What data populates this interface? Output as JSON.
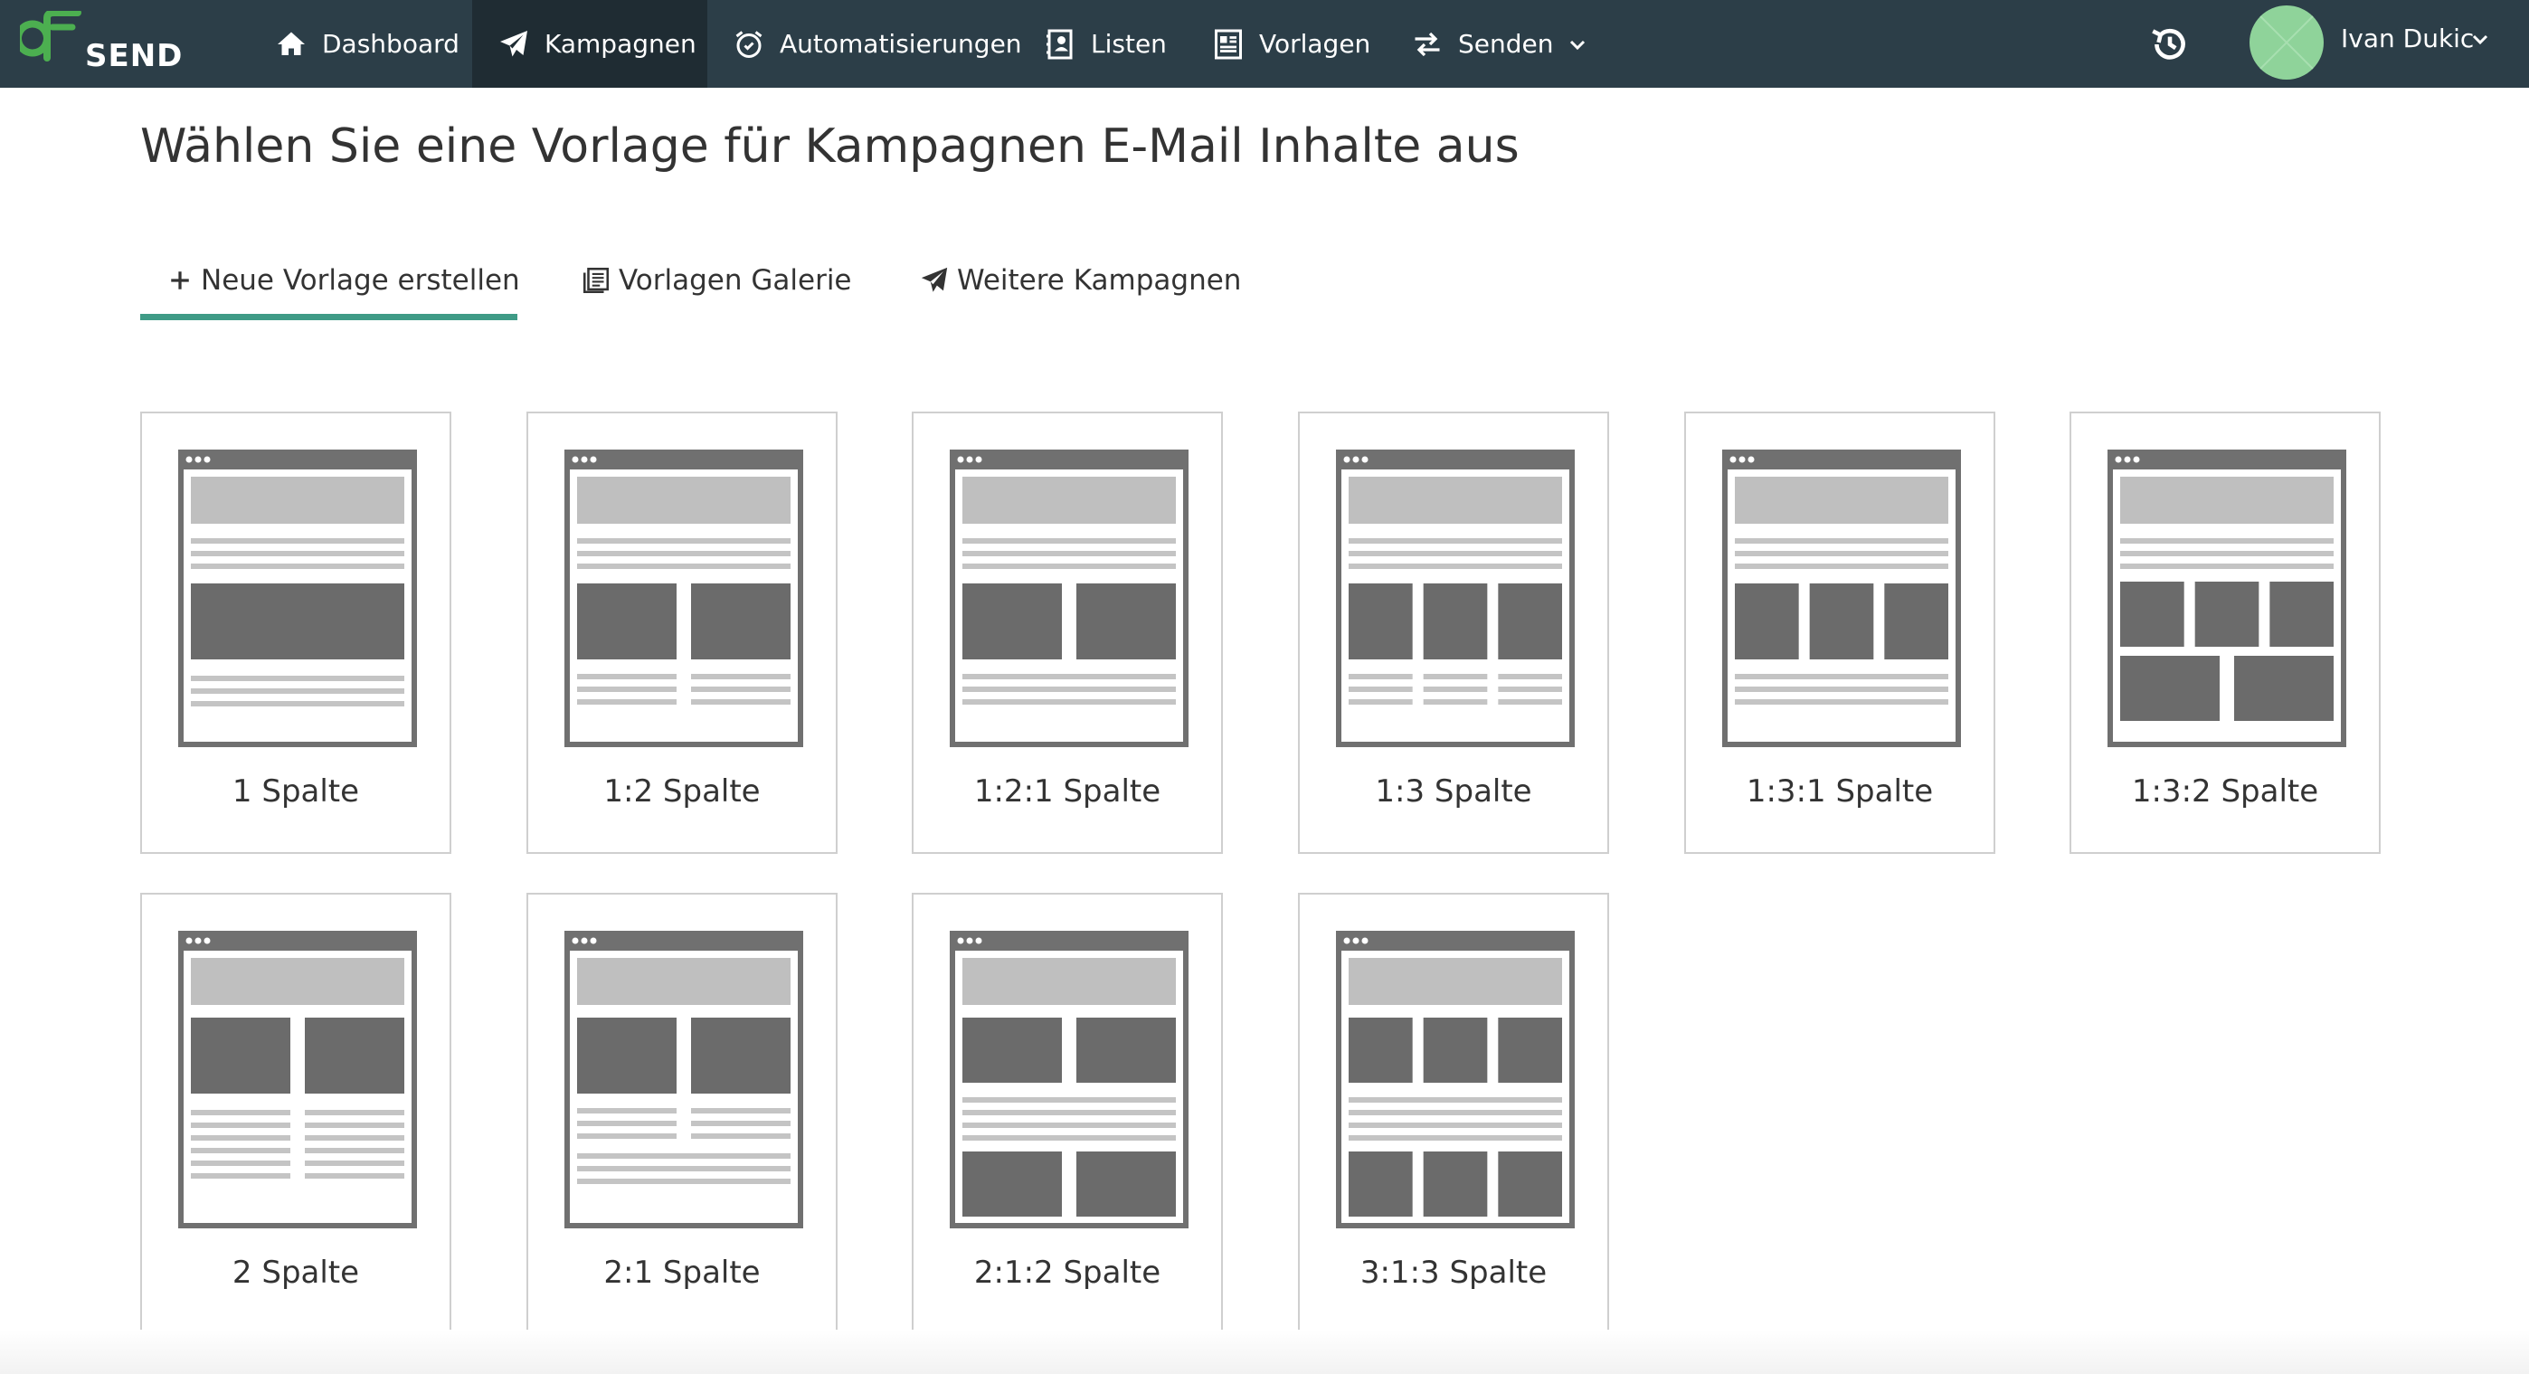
{
  "brand": {
    "logo_text": "SEND",
    "accent_color": "#3f9b86",
    "logo_color": "#4caf50"
  },
  "navbar": {
    "items": [
      {
        "label": "Dashboard",
        "icon": "home-icon"
      },
      {
        "label": "Kampagnen",
        "icon": "paper-plane-icon",
        "active": true
      },
      {
        "label": "Automatisierungen",
        "icon": "alarm-clock-icon"
      },
      {
        "label": "Listen",
        "icon": "contact-list-icon"
      },
      {
        "label": "Vorlagen",
        "icon": "template-icon"
      },
      {
        "label": "Senden",
        "icon": "exchange-arrows-icon",
        "has_dropdown": true
      }
    ],
    "history_icon": "history-icon",
    "user": {
      "name": "Ivan Dukic"
    }
  },
  "page": {
    "title": "Wählen Sie eine Vorlage für Kampagnen E-Mail Inhalte aus",
    "tabs": [
      {
        "label": "Neue Vorlage erstellen",
        "icon": "plus-icon",
        "active": true
      },
      {
        "label": "Vorlagen Galerie",
        "icon": "gallery-icon"
      },
      {
        "label": "Weitere Kampagnen",
        "icon": "paper-plane-icon"
      }
    ]
  },
  "templates": [
    {
      "label": "1 Spalte",
      "layout": "1"
    },
    {
      "label": "1:2 Spalte",
      "layout": "1:2"
    },
    {
      "label": "1:2:1 Spalte",
      "layout": "1:2:1"
    },
    {
      "label": "1:3 Spalte",
      "layout": "1:3"
    },
    {
      "label": "1:3:1 Spalte",
      "layout": "1:3:1"
    },
    {
      "label": "1:3:2 Spalte",
      "layout": "1:3:2"
    },
    {
      "label": "2 Spalte",
      "layout": "2"
    },
    {
      "label": "2:1 Spalte",
      "layout": "2:1"
    },
    {
      "label": "2:1:2 Spalte",
      "layout": "2:1:2"
    },
    {
      "label": "3:1:3 Spalte",
      "layout": "3:1:3"
    }
  ],
  "colors": {
    "navbar_bg": "#2c3e48",
    "navbar_active": "#1f2c33",
    "thumb_frame": "#707070",
    "thumb_header": "#bfbfbf",
    "thumb_block": "#6b6b6b",
    "thumb_line": "#c4c4c4",
    "card_border": "#cfcfcf"
  }
}
